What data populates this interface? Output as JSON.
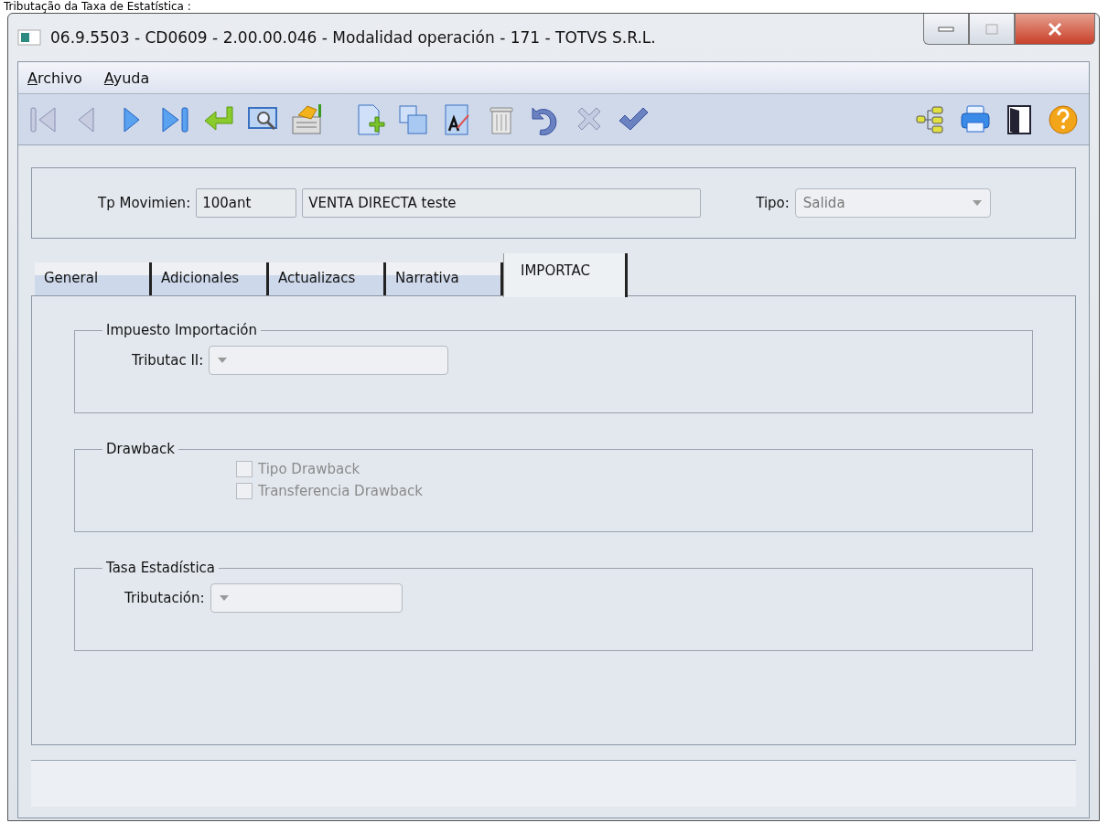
{
  "caption": "Tributação da Taxa de Estatística :",
  "window": {
    "title": "06.9.5503 - CD0609 - 2.00.00.046 - Modalidad operación - 171 - TOTVS S.R.L."
  },
  "menu": [
    {
      "label": "Archivo"
    },
    {
      "label": "Ayuda"
    }
  ],
  "header": {
    "movement_label": "Tp Movimien:",
    "movement_code": "100ant",
    "movement_description": "VENTA  DIRECTA teste",
    "type_label": "Tipo:",
    "type_value": "Salida"
  },
  "tabs": [
    {
      "label": "General",
      "selected": false
    },
    {
      "label": "Adicionales",
      "selected": false
    },
    {
      "label": "Actualizacs",
      "selected": false
    },
    {
      "label": "Narrativa",
      "selected": false
    },
    {
      "label": "IMPORTAC",
      "selected": true
    }
  ],
  "groups": [
    {
      "title": "Impuesto Importación",
      "fields": [
        {
          "kind": "select",
          "label": "Tributac II:"
        }
      ]
    },
    {
      "title": "Drawback",
      "fields": [
        {
          "kind": "checkbox",
          "label": "Tipo Drawback",
          "checked": false,
          "disabled": true
        },
        {
          "kind": "checkbox",
          "label": "Transferencia Drawback",
          "checked": false,
          "disabled": true
        }
      ]
    },
    {
      "title": "Tasa Estadística",
      "fields": [
        {
          "kind": "select",
          "label": "Tributación:"
        }
      ]
    }
  ]
}
